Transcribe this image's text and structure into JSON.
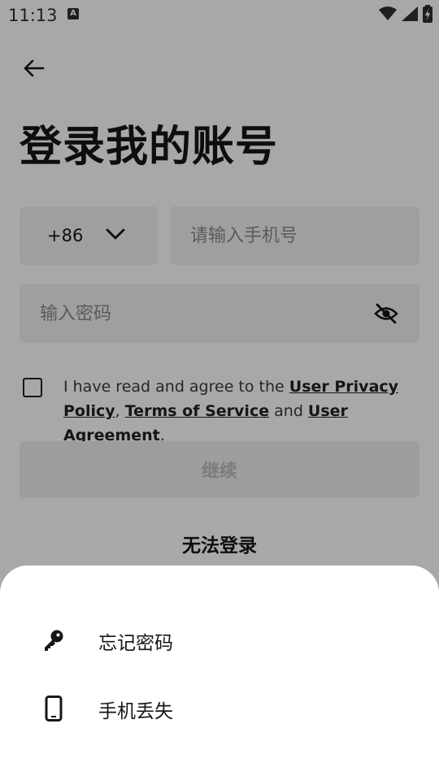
{
  "status_bar": {
    "time": "11:13",
    "badge": "A"
  },
  "header": {
    "title": "登录我的账号"
  },
  "form": {
    "country_code": "+86",
    "phone_placeholder": "请输入手机号",
    "password_placeholder": "输入密码"
  },
  "agreement": {
    "prefix": "I have read and agree to the ",
    "privacy": "User Privacy Policy",
    "sep1": ", ",
    "terms": "Terms of Service",
    "sep2": " and ",
    "user_agreement": "User Agreement",
    "suffix": "."
  },
  "continue_label": "继续",
  "cant_login_label": "无法登录",
  "sheet": {
    "items": [
      {
        "label": "忘记密码",
        "icon": "key-icon"
      },
      {
        "label": "手机丢失",
        "icon": "phone-icon"
      }
    ]
  }
}
